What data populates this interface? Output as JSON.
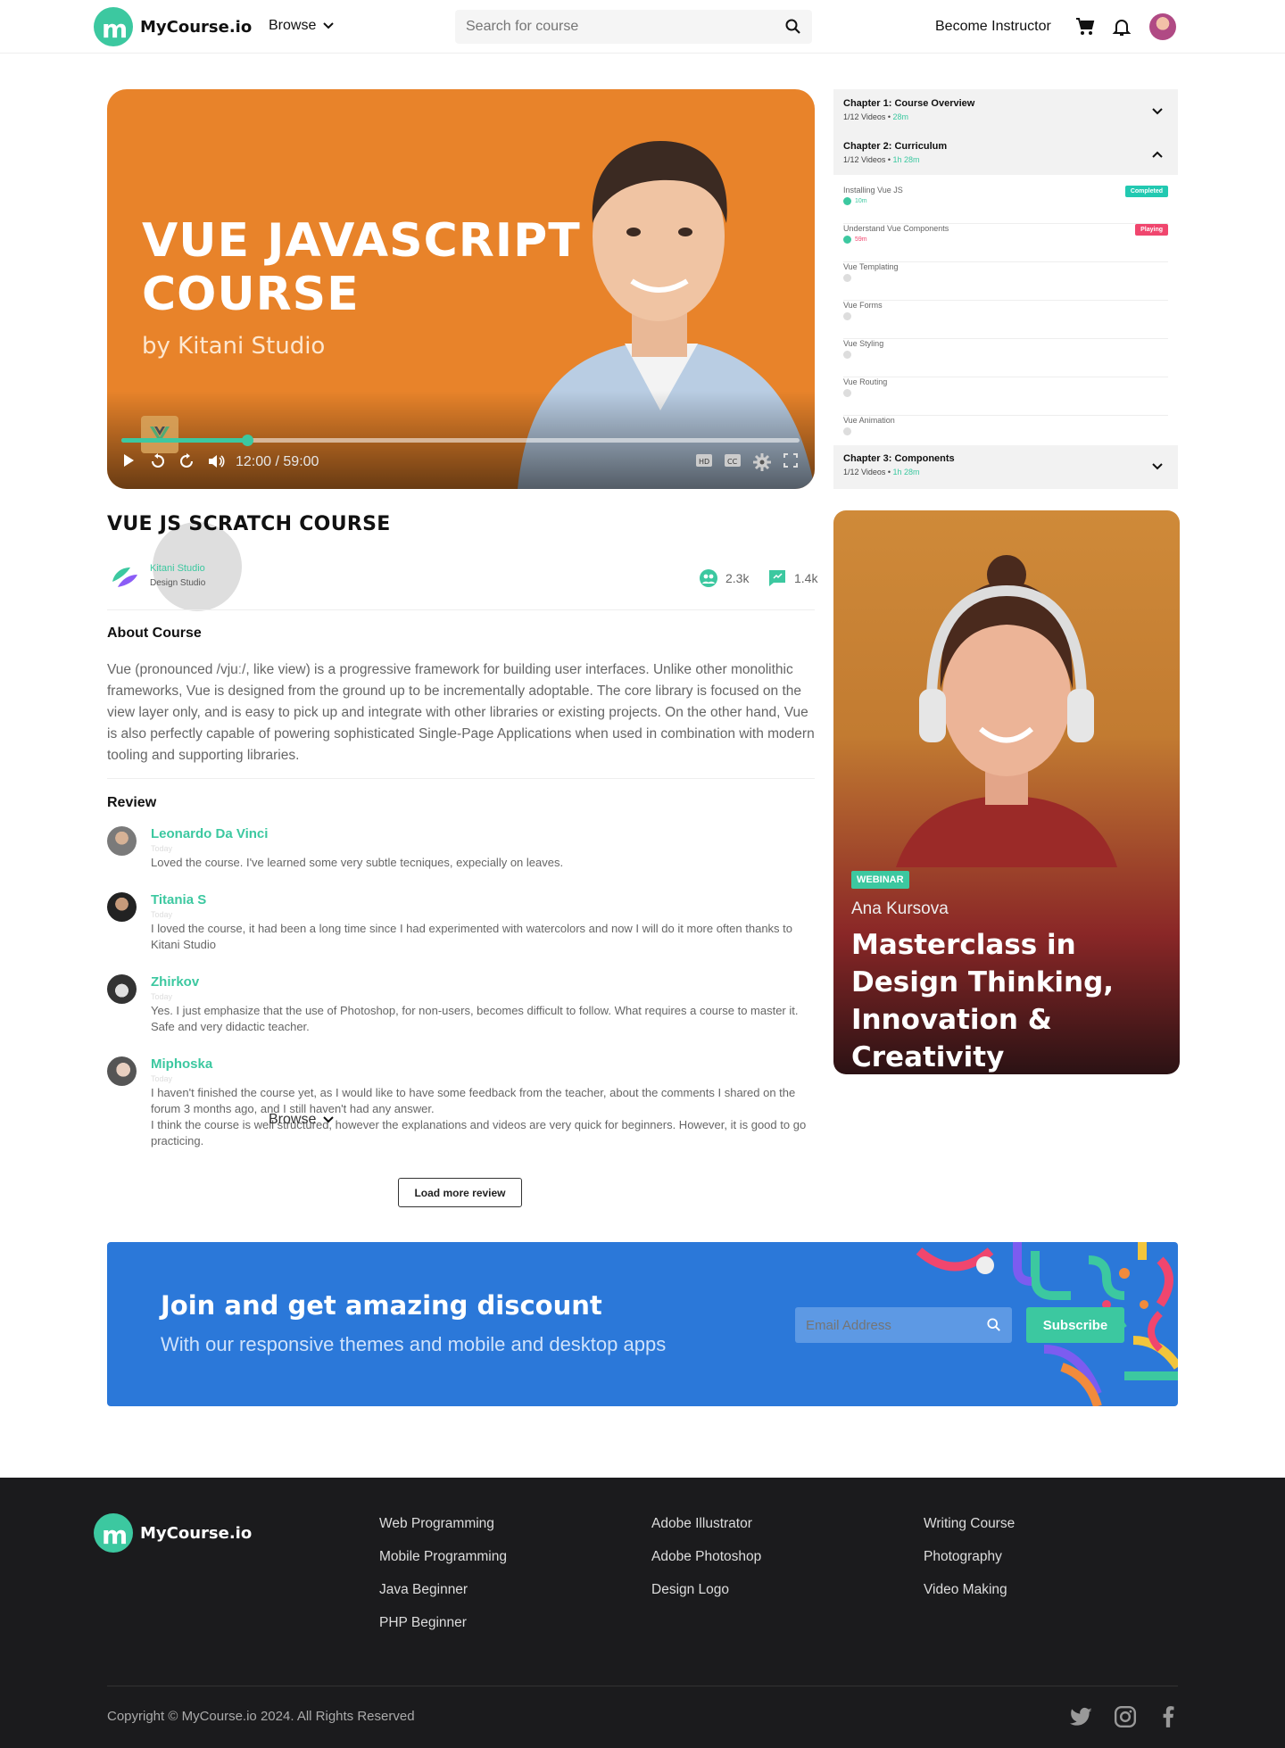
{
  "header": {
    "logo_text": "MyCourse.io",
    "browse_label": "Browse",
    "search_placeholder": "Search for course",
    "become_instructor": "Become Instructor"
  },
  "video": {
    "title_line1": "VUE JAVASCRIPT",
    "title_line2": "COURSE",
    "byline": "by Kitani Studio",
    "current_time": "12:00",
    "total_time": "59:00",
    "progress_fraction": 0.185
  },
  "chapters": [
    {
      "title": "Chapter 1: Course Overview",
      "videos": "1/12 Videos",
      "duration": "28m",
      "expanded": false
    },
    {
      "title": "Chapter 2: Curriculum",
      "videos": "1/12 Videos",
      "duration": "1h 28m",
      "expanded": true
    },
    {
      "title": "Chapter 3: Components",
      "videos": "1/12 Videos",
      "duration": "1h 28m",
      "expanded": false
    }
  ],
  "lessons": [
    {
      "title": "Installing Vue JS",
      "duration": "10m",
      "status": "Completed"
    },
    {
      "title": "Understand Vue Components",
      "duration": "59m",
      "status": "Playing"
    },
    {
      "title": "Vue Templating",
      "duration": "",
      "status": ""
    },
    {
      "title": "Vue Forms",
      "duration": "",
      "status": ""
    },
    {
      "title": "Vue Styling",
      "duration": "",
      "status": ""
    },
    {
      "title": "Vue Routing",
      "duration": "",
      "status": ""
    },
    {
      "title": "Vue Animation",
      "duration": "",
      "status": ""
    }
  ],
  "course": {
    "title": "VUE JS SCRATCH COURSE",
    "studio_name": "Kitani Studio",
    "studio_role": "Design Studio",
    "students": "2.3k",
    "comments": "1.4k"
  },
  "about": {
    "heading": "About Course",
    "text": "Vue (pronounced /vjuː/, like view) is a progressive framework for building user interfaces. Unlike other monolithic frameworks, Vue is designed from the ground up to be incrementally adoptable. The core library is focused on the view layer only, and is easy to pick up and integrate with other libraries or existing projects. On the other hand, Vue is also perfectly capable of powering sophisticated Single-Page Applications when used in combination with modern tooling and supporting libraries."
  },
  "reviews": {
    "heading": "Review",
    "items": [
      {
        "name": "Leonardo  Da Vinci",
        "date": "Today",
        "text": "Loved the course. I've learned some very subtle tecniques, expecially on leaves."
      },
      {
        "name": "Titania  S",
        "date": "Today",
        "text": "I loved the course, it had been a long time since I had experimented with watercolors and now I will do it more often thanks to Kitani Studio"
      },
      {
        "name": "Zhirkov",
        "date": "Today",
        "text": "Yes. I just emphasize that the use of Photoshop, for non-users, becomes difficult to follow. What requires a course to master it. Safe and very didactic teacher."
      },
      {
        "name": "Miphoska",
        "date": "Today",
        "text": "I haven't finished the course yet, as I would like to have some feedback from the teacher, about the comments I shared on the forum 3 months ago, and I still haven't had any answer.\nI think the course is well structured, however the explanations and videos are very quick for beginners. However, it is good to go practicing."
      }
    ],
    "ghost_browse": "Browse",
    "load_more": "Load more review"
  },
  "webinar": {
    "badge": "WEBINAR",
    "author": "Ana Kursova",
    "title": "Masterclass in Design Thinking, Innovation & Creativity"
  },
  "promo": {
    "title": "Join and get amazing discount",
    "subtitle": "With our responsive themes and mobile and desktop apps",
    "email_placeholder": "Email Address",
    "subscribe": "Subscribe"
  },
  "footer": {
    "logo_text": "MyCourse.io",
    "col1": [
      "Web Programming",
      "Mobile Programming",
      "Java Beginner",
      "PHP Beginner"
    ],
    "col2": [
      "Adobe Illustrator",
      "Adobe Photoshop",
      "Design Logo"
    ],
    "col3": [
      "Writing Course",
      "Photography",
      "Video Making"
    ],
    "copyright": "Copyright © MyCourse.io 2024. All Rights Reserved"
  },
  "colors": {
    "accent": "#3cc8a0",
    "video_bg": "#e8832a",
    "promo_bg": "#2b78d9",
    "playing": "#f0466e",
    "footer_bg": "#1b1b1d"
  }
}
